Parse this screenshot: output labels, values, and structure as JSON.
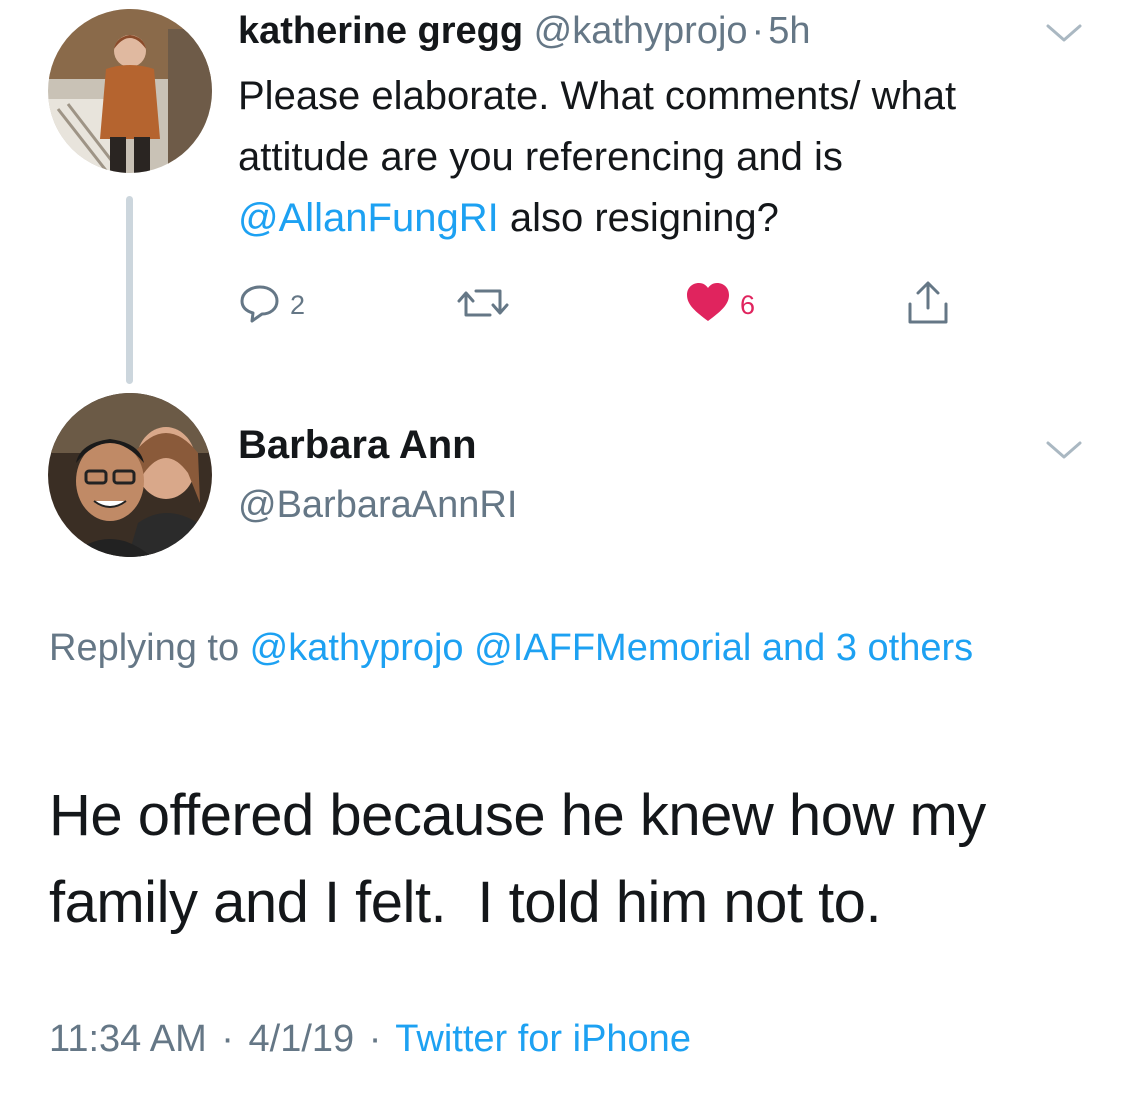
{
  "tweet1": {
    "author_name": "katherine gregg",
    "author_handle": "@kathyprojo",
    "separator": "·",
    "time": "5h",
    "body_parts": [
      "Please elaborate. What comments/ what attitude are you referencing and is ",
      "@AllanFungRI",
      " also resigning?"
    ],
    "reply_count": "2",
    "retweet_count": "",
    "like_count": "6",
    "liked": true,
    "icons": {
      "reply": "reply-icon",
      "retweet": "retweet-icon",
      "like": "heart-icon",
      "share": "share-icon",
      "menu": "chevron-down-icon"
    }
  },
  "tweet2": {
    "author_name": "Barbara Ann",
    "author_handle": "@BarbaraAnnRI",
    "replying_prefix": "Replying to ",
    "replying_mention_1": "@kathyprojo",
    "replying_mention_2": "@IAFFMemorial",
    "replying_others": "and 3 others",
    "text": "He offered because he knew how my family and I felt.  I told him not to.",
    "timestamp": "11:34 AM",
    "date": "4/1/19",
    "source": "Twitter for iPhone",
    "dot": "·"
  },
  "colors": {
    "link": "#1da1f2",
    "muted": "#657786",
    "like": "#e0245e",
    "thread_line": "#ccd6dd",
    "text": "#14171a"
  }
}
